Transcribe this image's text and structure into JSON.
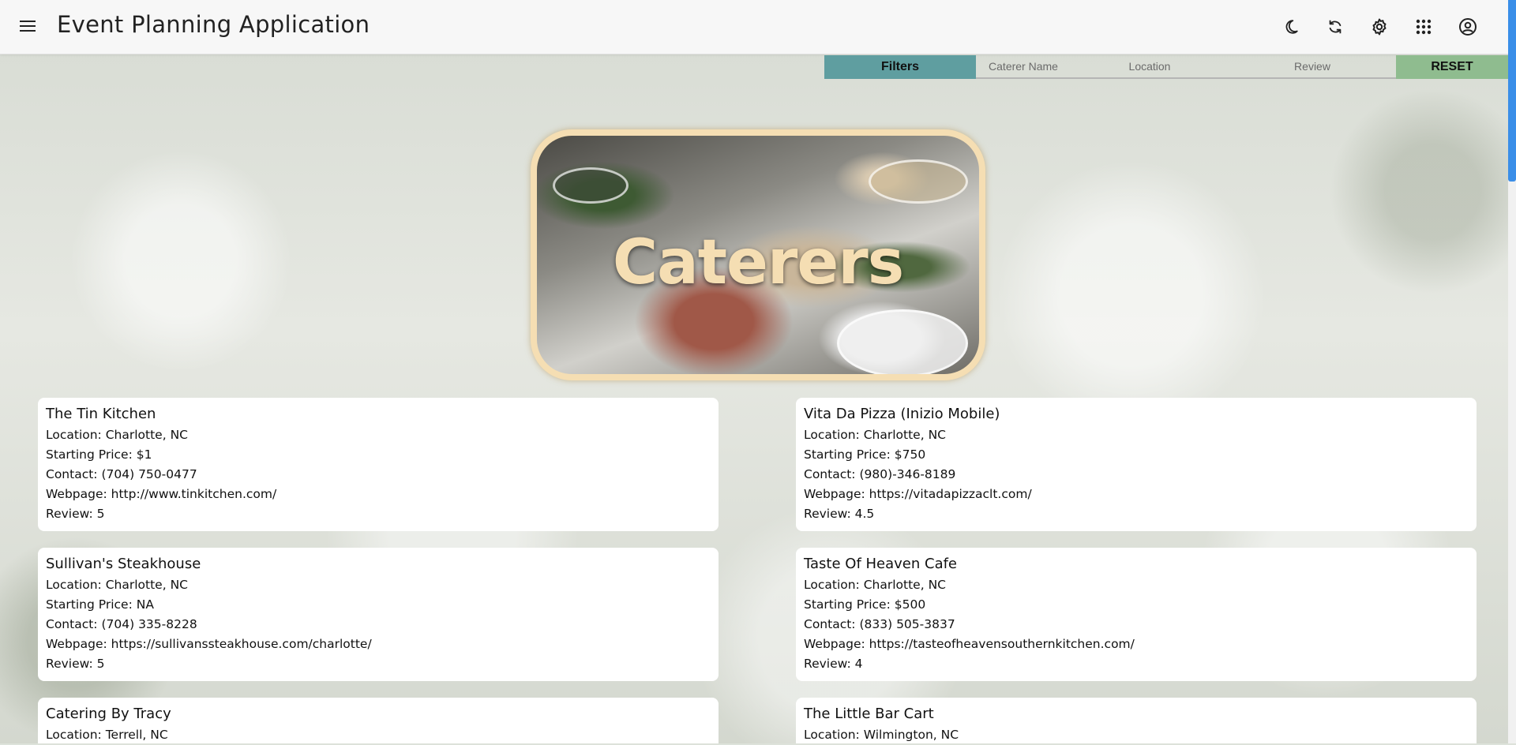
{
  "app": {
    "title": "Event Planning Application"
  },
  "topbar": {
    "icons": [
      "moon-icon",
      "sync-icon",
      "gear-icon",
      "apps-grid-icon",
      "account-circle-icon"
    ]
  },
  "filters": {
    "label": "Filters",
    "caterer_placeholder": "Caterer Name",
    "location_placeholder": "Location",
    "review_placeholder": "Review",
    "reset_label": "RESET"
  },
  "hero": {
    "title": "Caterers"
  },
  "labels": {
    "location": "Location: ",
    "starting_price": "Starting Price: ",
    "contact": "Contact: ",
    "webpage": "Webpage: ",
    "review": "Review: "
  },
  "caterers": [
    {
      "name": "The Tin Kitchen",
      "location": "Charlotte, NC",
      "starting_price": "$1",
      "contact": "(704) 750-0477",
      "webpage": "http://www.tinkitchen.com/",
      "review": "5"
    },
    {
      "name": "Vita Da Pizza (Inizio Mobile)",
      "location": "Charlotte, NC",
      "starting_price": "$750",
      "contact": "(980)-346-8189",
      "webpage": "https://vitadapizzaclt.com/",
      "review": "4.5"
    },
    {
      "name": "Sullivan's Steakhouse",
      "location": "Charlotte, NC",
      "starting_price": "NA",
      "contact": "(704) 335-8228",
      "webpage": "https://sullivanssteakhouse.com/charlotte/",
      "review": "5"
    },
    {
      "name": "Taste Of Heaven Cafe",
      "location": "Charlotte, NC",
      "starting_price": "$500",
      "contact": "(833) 505-3837",
      "webpage": "https://tasteofheavensouthernkitchen.com/",
      "review": "4"
    },
    {
      "name": "Catering By Tracy",
      "location": "Terrell, NC"
    },
    {
      "name": "The Little Bar Cart",
      "location": "Wilmington, NC"
    }
  ]
}
